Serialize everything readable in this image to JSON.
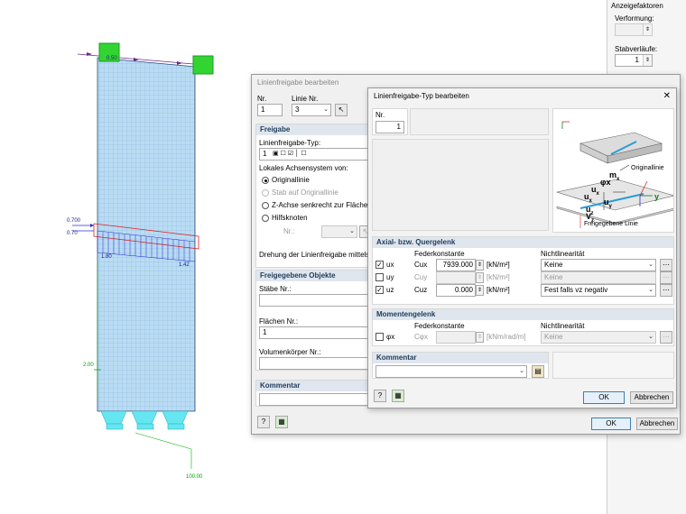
{
  "right_panel": {
    "title": "Anzeigefaktoren",
    "deformation_label": "Verformung:",
    "member_diagrams_label": "Stabverläufe:",
    "member_diagrams_value": "1"
  },
  "model": {
    "top_label": "0.50",
    "left_labels": [
      "0.700",
      "0.70"
    ],
    "label_1_80": "1.80",
    "label_1_42": "1.42",
    "label_2_00": "2.00",
    "label_100": "100.00"
  },
  "back_dialog": {
    "title": "Linienfreigabe bearbeiten",
    "nr_label": "Nr.",
    "nr_value": "1",
    "linie_label": "Linie Nr.",
    "linie_value": "3",
    "freigabe_section": "Freigabe",
    "type_label": "Linienfreigabe-Typ:",
    "type_value": "1",
    "axis_system_label": "Lokales Achsensystem von:",
    "radio_original": "Originallinie",
    "radio_stab": "Stab auf Originallinie",
    "radio_z": "Z-Achse senkrecht zur Fläche Nr.:",
    "radio_hilf": "Hilfsknoten",
    "nr_short": "Nr.:",
    "rotation_label": "Drehung der Linienfreigabe mittels Winke",
    "objects_section": "Freigegebene Objekte",
    "staebe_label": "Stäbe Nr.:",
    "flaechen_label": "Flächen Nr.:",
    "flaechen_value": "1",
    "volumen_label": "Volumenkörper Nr.:",
    "comment_section": "Kommentar",
    "ok": "OK",
    "cancel": "Abbrechen"
  },
  "front_dialog": {
    "title": "Linienfreigabe-Typ bearbeiten",
    "nr_label": "Nr.",
    "nr_value": "1",
    "diagram": {
      "mx": "m",
      "phix": "φx",
      "ux": "u",
      "uy": "u",
      "uz": "u",
      "vz": "V",
      "y_axis": "y",
      "originallinie": "Originallinie",
      "freigegebene": "Freigegebene Linie"
    },
    "axial_section": "Axial- bzw. Quergelenk",
    "col_spring": "Federkonstante",
    "col_nonlin": "Nichtlinearität",
    "rows": [
      {
        "name": "ux",
        "checked": true,
        "c_label": "Cux",
        "value": "7939.000",
        "unit": "[kN/m²]",
        "nonlin": "Keine",
        "enabled": true
      },
      {
        "name": "uy",
        "checked": false,
        "c_label": "Cuy",
        "value": "",
        "unit": "[kN/m²]",
        "nonlin": "Keine",
        "enabled": false
      },
      {
        "name": "uz",
        "checked": true,
        "c_label": "Cuz",
        "value": "0.000",
        "unit": "[kN/m²]",
        "nonlin": "Fest falls vz negativ",
        "enabled": true
      }
    ],
    "moment_section": "Momentengelenk",
    "moment_row": {
      "name": "φx",
      "c_label": "Cφx",
      "value": "",
      "unit": "[kNm/rad/m]",
      "nonlin": "Keine"
    },
    "comment_section": "Kommentar",
    "ok": "OK",
    "cancel": "Abbrechen",
    "close_symbol": "✕"
  }
}
